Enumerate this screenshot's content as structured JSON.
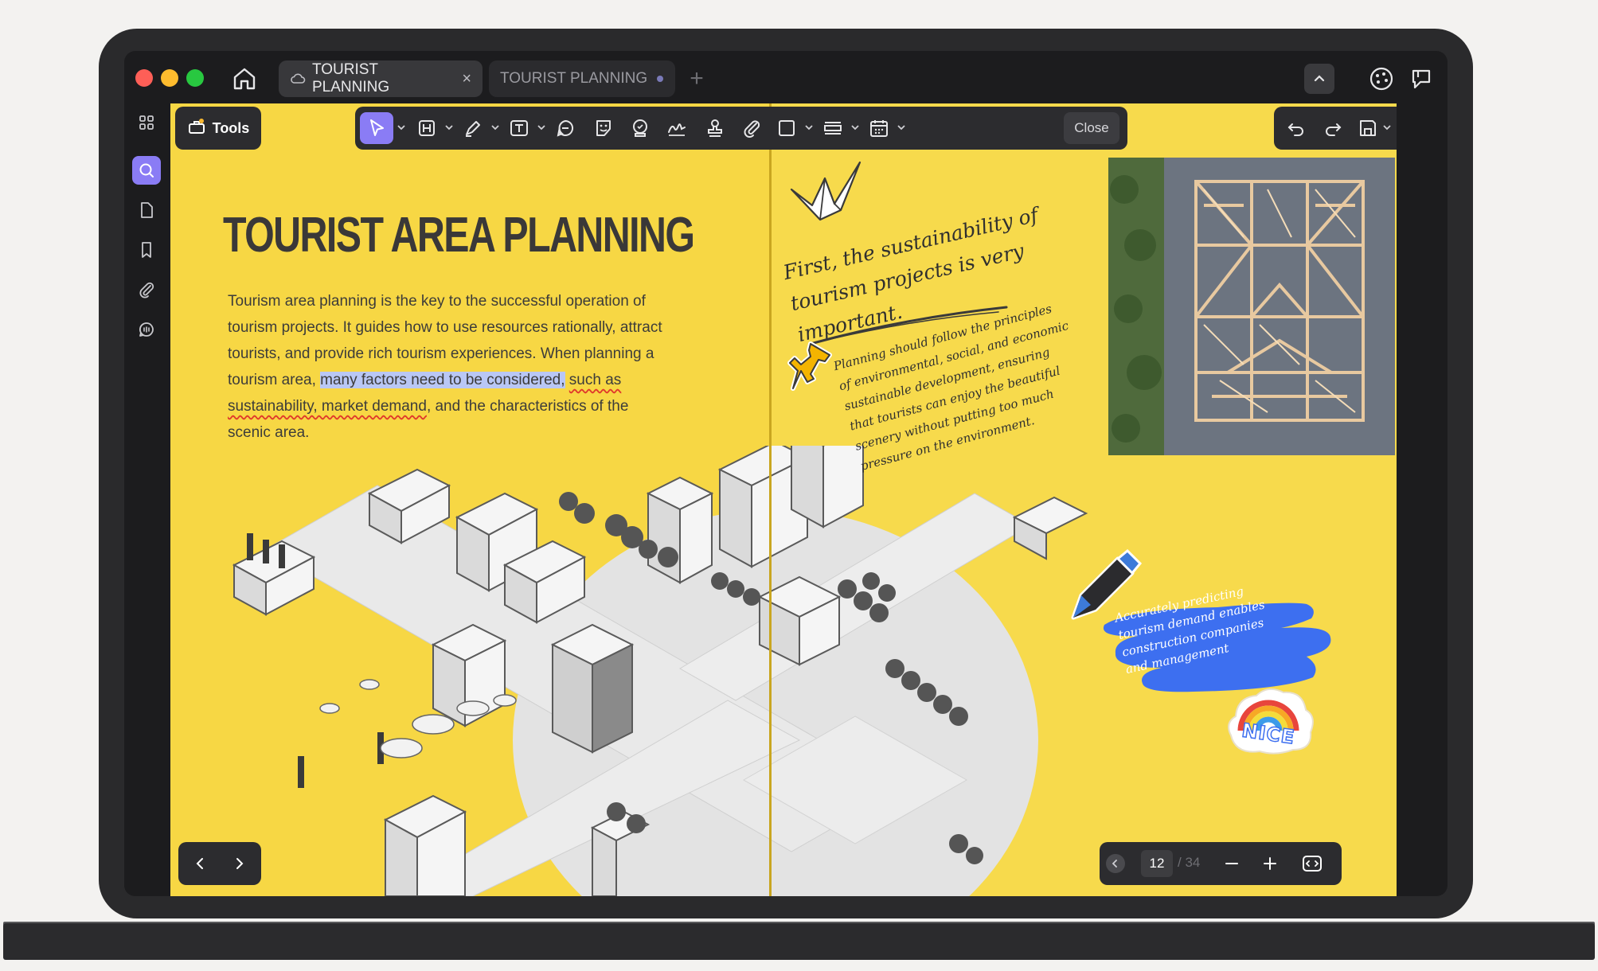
{
  "window": {
    "tabs": [
      {
        "label": "TOURIST PLANNING",
        "active": true
      },
      {
        "label": "TOURIST PLANNING",
        "active": false
      }
    ]
  },
  "toolbar": {
    "tools_label": "Tools",
    "close_label": "Close",
    "accent": "#8a7cf5"
  },
  "document": {
    "title": "TOURIST AREA PLANNING",
    "para_1": "Tourism area planning is the key to the successful operation of tourism projects.  It guides how to use resources rationally, attract tourists, and provide rich tourism experiences. When planning a tourism area, ",
    "para_highlight": "many factors need to be considered,",
    "para_underline": "such as sustainability, market demand",
    "para_end": ", and the characteristics of the scenic area.",
    "note_1": [
      "First, the sustainability of",
      "tourism projects is very",
      "important."
    ],
    "note_2": [
      "Planning should follow the principles",
      "of environmental, social, and economic",
      "sustainable development, ensuring",
      "that tourists can enjoy the beautiful",
      "scenery without putting too much",
      "pressure on the environment."
    ],
    "note_3": [
      "Accurately predicting",
      "tourism demand enables",
      "construction companies",
      "and management"
    ],
    "sticker_text": "NICE",
    "page_bg": "#f7d744"
  },
  "pager": {
    "current_page": "12",
    "total_pages": "/ 34"
  }
}
